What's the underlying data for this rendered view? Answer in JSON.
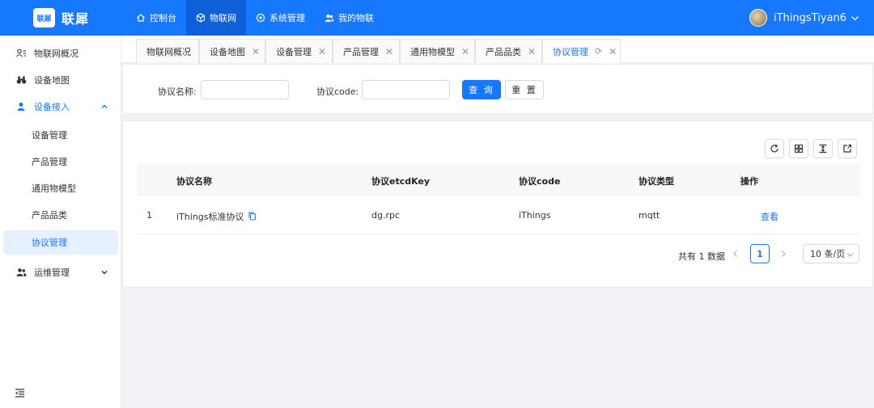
{
  "header": {
    "logo_badge": "联犀",
    "logo_text": "联犀",
    "nav": [
      {
        "label": "控制台"
      },
      {
        "label": "物联网"
      },
      {
        "label": "系统管理"
      },
      {
        "label": "我的物联"
      }
    ],
    "active_nav": "物联网",
    "username": "iThingsTiyan6"
  },
  "sidebar": {
    "items": [
      {
        "label": "物联网概况"
      },
      {
        "label": "设备地图"
      },
      {
        "label": "设备接入"
      },
      {
        "label": "运维管理"
      }
    ],
    "sub_items": [
      {
        "label": "设备管理"
      },
      {
        "label": "产品管理"
      },
      {
        "label": "通用物模型"
      },
      {
        "label": "产品品类"
      },
      {
        "label": "协议管理"
      }
    ],
    "selected": "协议管理"
  },
  "tabs": [
    {
      "label": "物联网概况"
    },
    {
      "label": "设备地图"
    },
    {
      "label": "设备管理"
    },
    {
      "label": "产品管理"
    },
    {
      "label": "通用物模型"
    },
    {
      "label": "产品品类"
    },
    {
      "label": "协议管理"
    }
  ],
  "search": {
    "name_label": "协议名称:",
    "name_value": "",
    "code_label": "协议code:",
    "code_value": "",
    "query_button": "查 询",
    "reset_button": "重 置"
  },
  "table": {
    "columns": [
      "协议名称",
      "协议etcdKey",
      "协议code",
      "协议类型",
      "操作"
    ],
    "rows": [
      {
        "index": "1",
        "name": "iThings标准协议",
        "etcd_key": "dg.rpc",
        "code": "iThings",
        "type": "mqtt",
        "action": "查看"
      }
    ]
  },
  "pagination": {
    "total_text": "共有 1 数据",
    "current_page": "1",
    "page_size": "10 条/页"
  },
  "colors": {
    "primary": "#1677ff",
    "selected_bg": "#e6f0ff"
  }
}
